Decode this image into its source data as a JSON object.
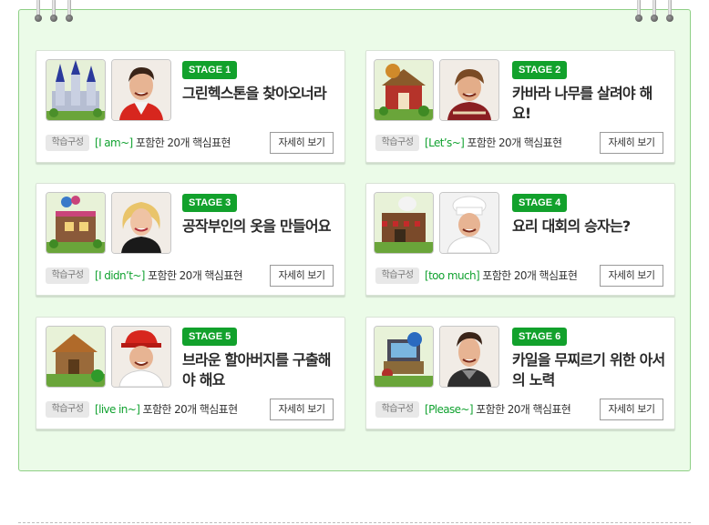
{
  "stages": [
    {
      "badge": "STAGE 1",
      "title": "그린헥스톤을 찾아오너라",
      "tag": "학습구성",
      "phrase": "[I am~]",
      "desc": "포함한 20개 핵심표현",
      "button": "자세히 보기"
    },
    {
      "badge": "STAGE 2",
      "title": "카바라 나무를 살려야 해요!",
      "tag": "학습구성",
      "phrase": "[Let’s~]",
      "desc": "포함한 20개 핵심표현",
      "button": "자세히 보기"
    },
    {
      "badge": "STAGE 3",
      "title": "공작부인의 옷을 만들어요",
      "tag": "학습구성",
      "phrase": "[I didn’t~]",
      "desc": "포함한 20개 핵심표현",
      "button": "자세히 보기"
    },
    {
      "badge": "STAGE 4",
      "title": "요리 대회의 승자는?",
      "tag": "학습구성",
      "phrase": "[too much]",
      "desc": "포함한 20개 핵심표현",
      "button": "자세히 보기"
    },
    {
      "badge": "STAGE 5",
      "title": "브라운 할아버지를 구출해야 해요",
      "tag": "학습구성",
      "phrase": "[live in~]",
      "desc": "포함한 20개 핵심표현",
      "button": "자세히 보기"
    },
    {
      "badge": "STAGE 6",
      "title": "카일을 무찌르기 위한 아서의 노력",
      "tag": "학습구성",
      "phrase": "[Please~]",
      "desc": "포함한 20개 핵심표현",
      "button": "자세히 보기"
    }
  ],
  "colors": {
    "accent": "#12a12c",
    "board_bg": "#ebfbe8",
    "board_border": "#8fcf86"
  }
}
